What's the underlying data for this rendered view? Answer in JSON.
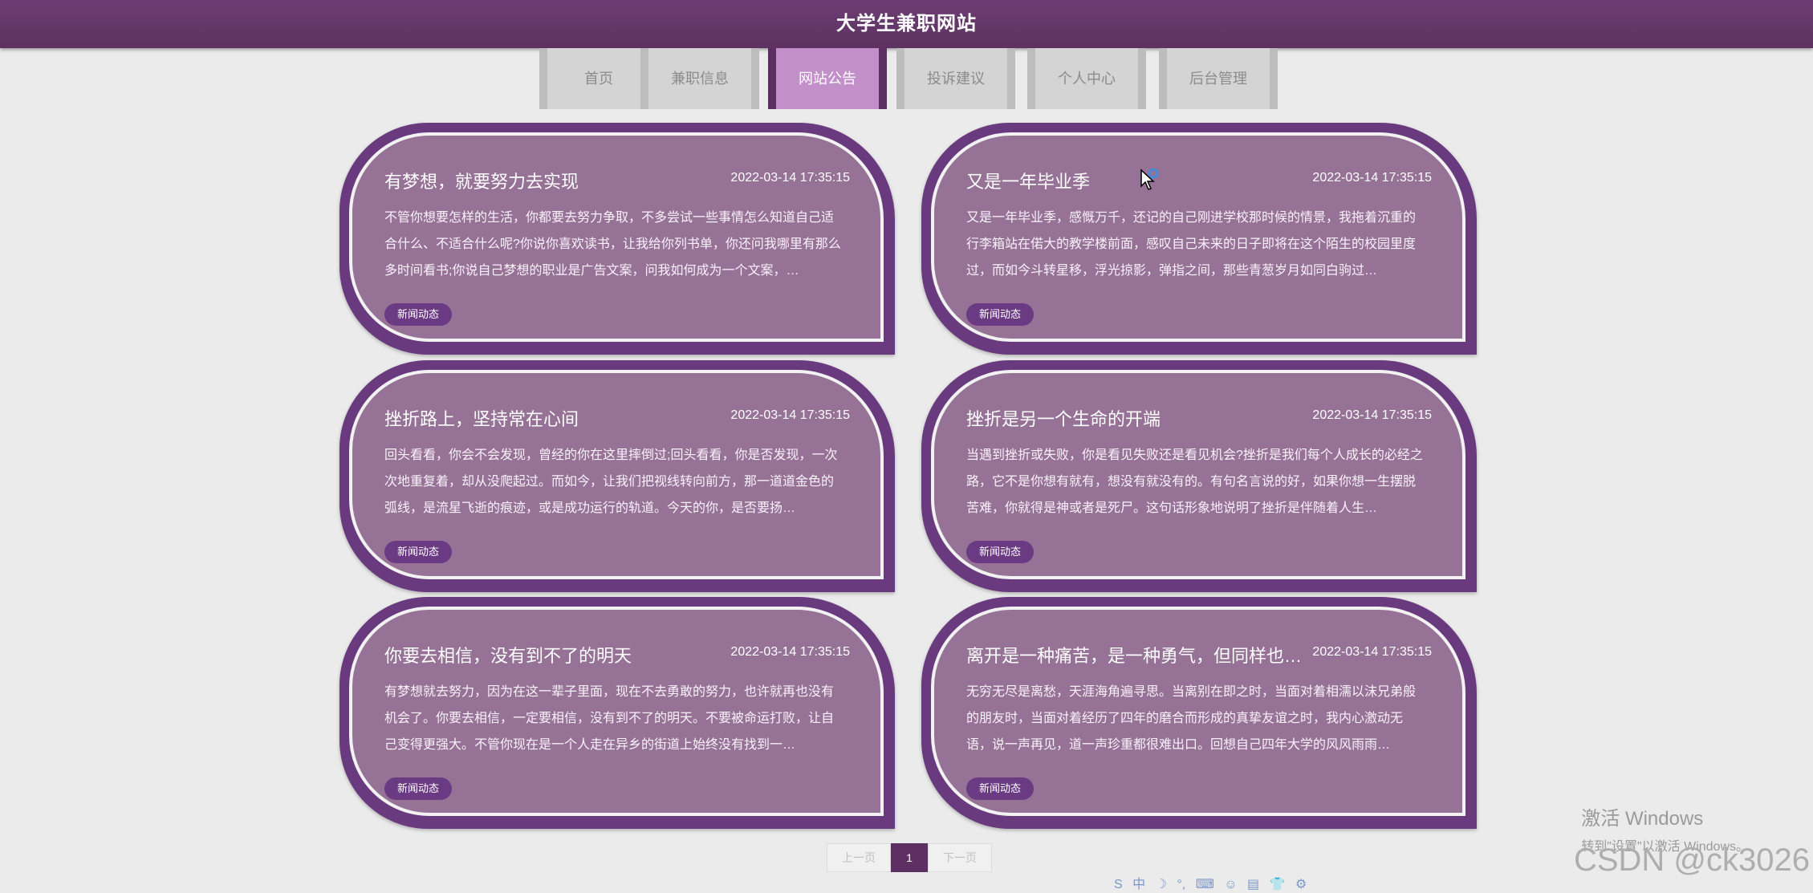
{
  "site": {
    "title": "大学生兼职网站"
  },
  "nav": {
    "tabs": [
      {
        "label": "首页"
      },
      {
        "label": "兼职信息"
      },
      {
        "label": "网站公告",
        "active": true
      },
      {
        "label": "投诉建议"
      },
      {
        "label": "个人中心"
      },
      {
        "label": "后台管理"
      }
    ]
  },
  "announcements": [
    {
      "title": "有梦想，就要努力去实现",
      "time": "2022-03-14 17:35:15",
      "excerpt": "不管你想要怎样的生活，你都要去努力争取，不多尝试一些事情怎么知道自己适合什么、不适合什么呢?你说你喜欢读书，让我给你列书单，你还问我哪里有那么多时间看书;你说自己梦想的职业是广告文案，问我如何成为一个文案，…",
      "tag": "新闻动态"
    },
    {
      "title": "又是一年毕业季",
      "time": "2022-03-14 17:35:15",
      "excerpt": "又是一年毕业季，感慨万千，还记的自己刚进学校那时候的情景，我拖着沉重的行李箱站在偌大的教学楼前面，感叹自己未来的日子即将在这个陌生的校园里度过，而如今斗转星移，浮光掠影，弹指之间，那些青葱岁月如同白驹过…",
      "tag": "新闻动态"
    },
    {
      "title": "挫折路上，坚持常在心间",
      "time": "2022-03-14 17:35:15",
      "excerpt": "回头看看，你会不会发现，曾经的你在这里摔倒过;回头看看，你是否发现，一次次地重复着，却从没爬起过。而如今，让我们把视线转向前方，那一道道金色的弧线，是流星飞逝的痕迹，或是成功运行的轨道。今天的你，是否要扬…",
      "tag": "新闻动态"
    },
    {
      "title": "挫折是另一个生命的开端",
      "time": "2022-03-14 17:35:15",
      "excerpt": "当遇到挫折或失败，你是看见失败还是看见机会?挫折是我们每个人成长的必经之路，它不是你想有就有，想没有就没有的。有句名言说的好，如果你想一生摆脱苦难，你就得是神或者是死尸。这句话形象地说明了挫折是伴随着人生…",
      "tag": "新闻动态"
    },
    {
      "title": "你要去相信，没有到不了的明天",
      "time": "2022-03-14 17:35:15",
      "excerpt": "有梦想就去努力，因为在这一辈子里面，现在不去勇敢的努力，也许就再也没有机会了。你要去相信，一定要相信，没有到不了的明天。不要被命运打败，让自己变得更强大。不管你现在是一个人走在异乡的街道上始终没有找到一…",
      "tag": "新闻动态"
    },
    {
      "title": "离开是一种痛苦，是一种勇气，但同样也…",
      "time": "2022-03-14 17:35:15",
      "excerpt": "无穷无尽是离愁，天涯海角遍寻思。当离别在即之时，当面对着相濡以沫兄弟般的朋友时，当面对着经历了四年的磨合而形成的真挚友谊之时，我内心激动无语，说一声再见，道一声珍重都很难出口。回想自己四年大学的风风雨雨…",
      "tag": "新闻动态"
    }
  ],
  "pagination": {
    "prev": "上一页",
    "current": "1",
    "next": "下一页"
  },
  "watermark": {
    "title": "激活 Windows",
    "subtitle": "转到\"设置\"以激活 Windows。"
  },
  "csdn_watermark": "CSDN @ck3026",
  "ime_toolbar": {
    "items": [
      "S",
      "中",
      "☽",
      "°,",
      "⌨",
      "☺",
      "▤",
      "👕",
      "⚙"
    ]
  }
}
